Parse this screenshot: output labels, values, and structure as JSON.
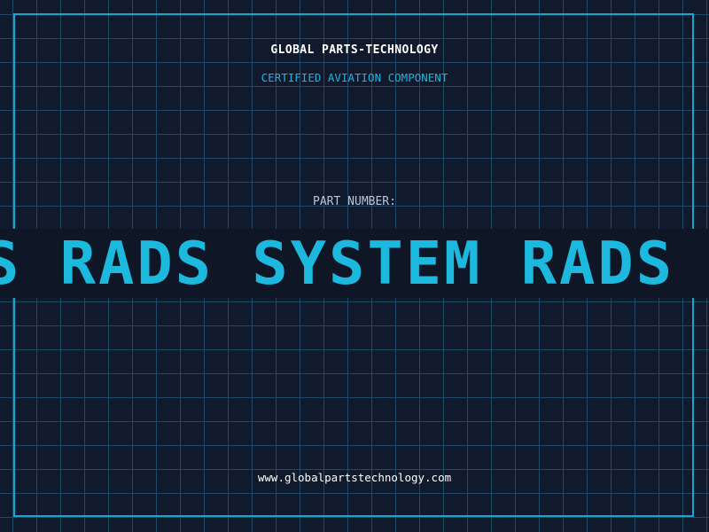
{
  "header": {
    "brand": "GLOBAL PARTS-TECHNOLOGY",
    "tagline": "CERTIFIED AVIATION COMPONENT"
  },
  "part": {
    "label": "PART NUMBER:",
    "marquee_text": "S RADS SYSTEM RADS"
  },
  "footer": {
    "website": "www.globalpartstechnology.com"
  },
  "colors": {
    "background": "#111a2c",
    "grid": "#1e4a63",
    "accent": "#1cb8de",
    "frame": "#12a9d0"
  }
}
